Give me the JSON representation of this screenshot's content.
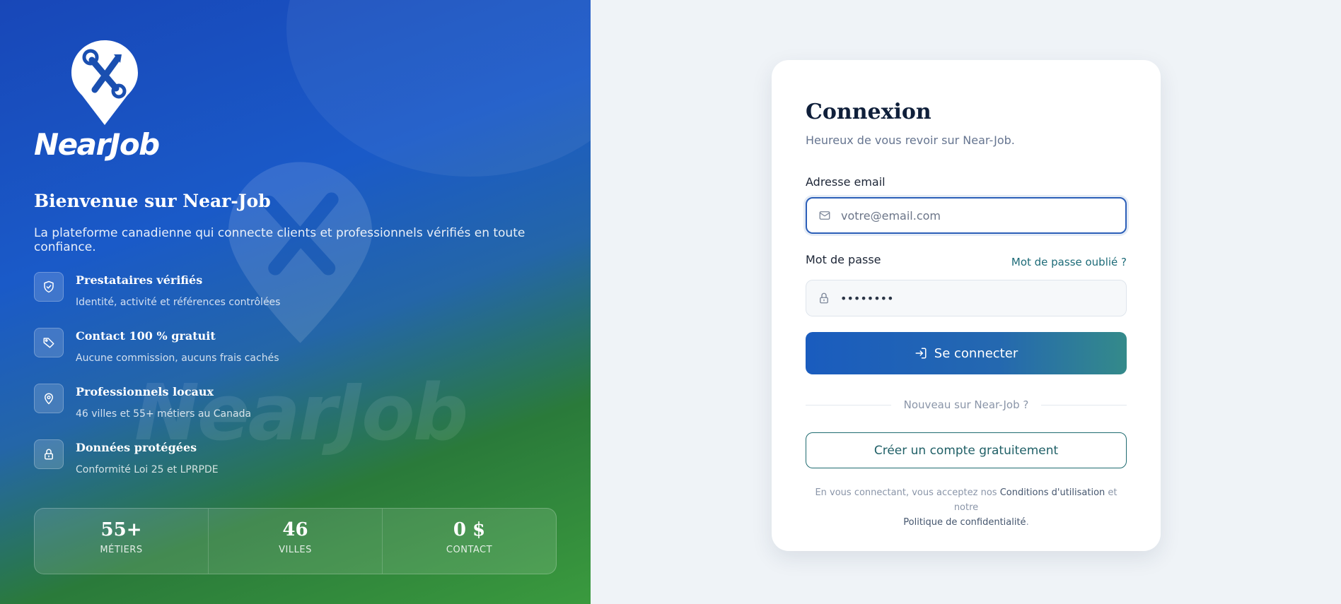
{
  "brand": {
    "name": "NearJob",
    "watermark": "NearJob"
  },
  "hero": {
    "title": "Bienvenue sur Near-Job",
    "tagline": "La plateforme canadienne qui connecte clients et professionnels vérifiés en toute confiance.",
    "features": [
      {
        "icon": "shield-check-icon",
        "title": "Prestataires vérifiés",
        "desc": "Identité, activité et références contrôlées"
      },
      {
        "icon": "tag-icon",
        "title": "Contact 100 % gratuit",
        "desc": "Aucune commission, aucuns frais cachés"
      },
      {
        "icon": "map-pin-icon",
        "title": "Professionnels locaux",
        "desc": "46 villes et 55+ métiers au Canada"
      },
      {
        "icon": "lock-icon",
        "title": "Données protégées",
        "desc": "Conformité Loi 25 et LPRPDE"
      }
    ],
    "stats": [
      {
        "value": "55+",
        "label": "MÉTIERS"
      },
      {
        "value": "46",
        "label": "VILLES"
      },
      {
        "value": "0 $",
        "label": "CONTACT"
      }
    ]
  },
  "login": {
    "title": "Connexion",
    "subtitle": "Heureux de vous revoir sur Near-Job.",
    "email_label": "Adresse email",
    "email_placeholder": "votre@email.com",
    "password_label": "Mot de passe",
    "password_value": "••••••••",
    "forgot_link": "Mot de passe oublié ?",
    "submit_label": "Se connecter",
    "divider_text": "Nouveau sur Near-Job ?",
    "create_label": "Créer un compte gratuitement",
    "terms_prefix": "En vous connectant, vous acceptez nos",
    "terms_link": "Conditions d'utilisation",
    "terms_and": "et notre",
    "privacy_link": "Politique de confidentialité",
    "terms_suffix": "."
  },
  "colors": {
    "accent": "#1a5cbe",
    "teal": "#1f6b70",
    "heroBlue": "#1847b8",
    "heroGreen": "#3a9a3e"
  }
}
